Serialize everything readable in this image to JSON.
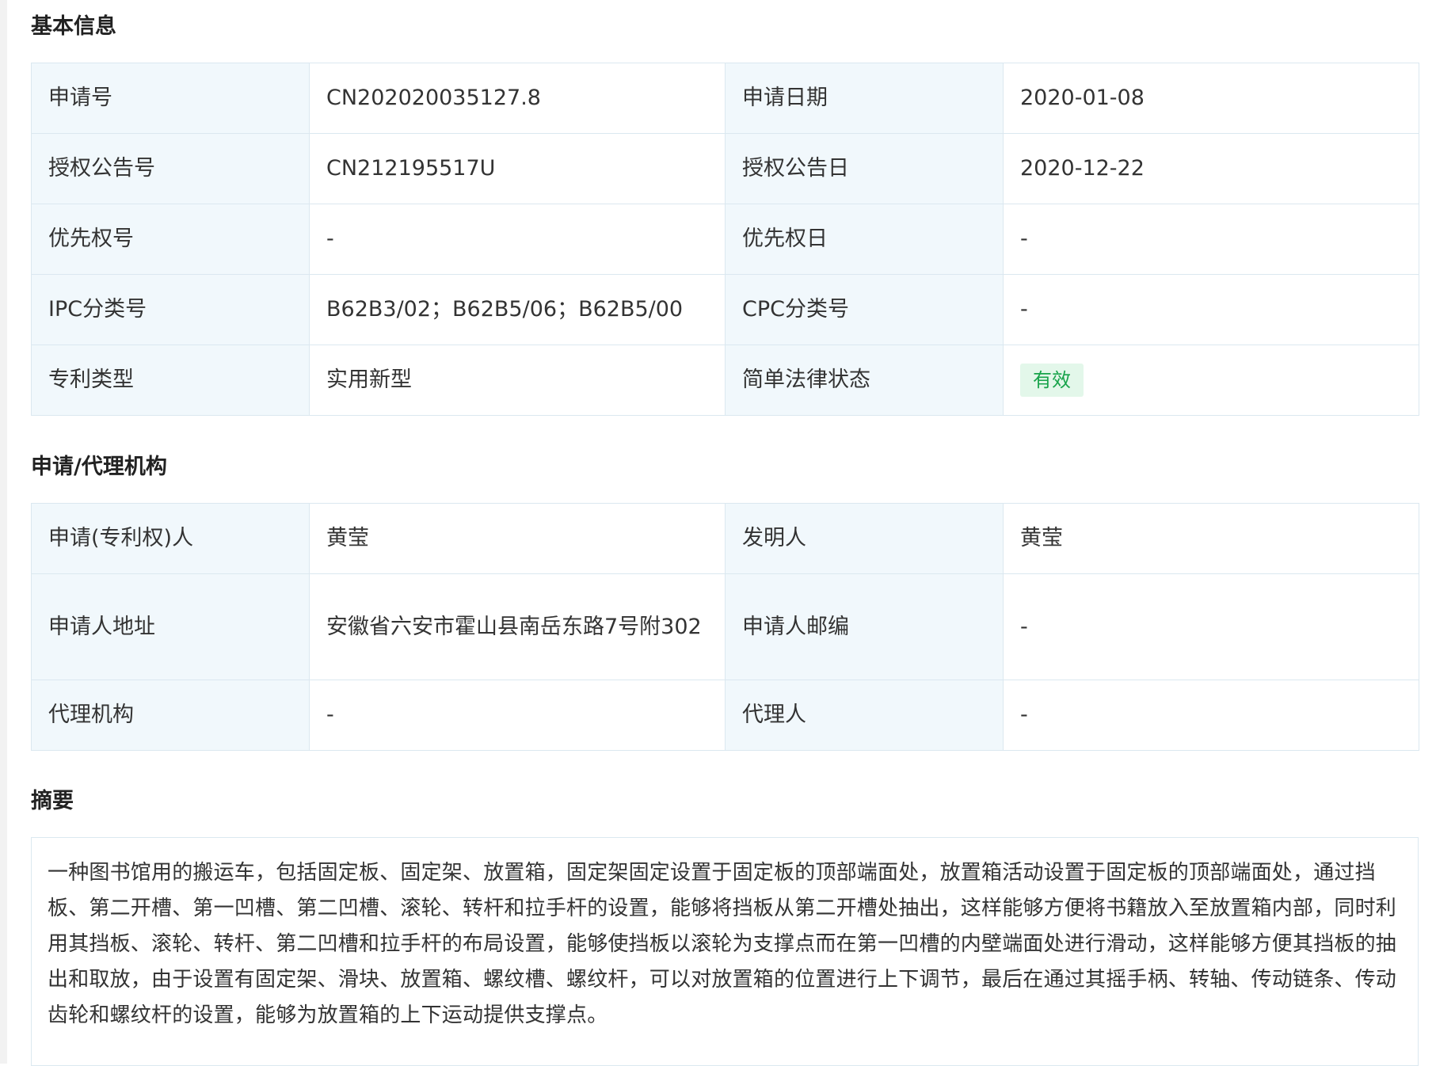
{
  "sections": {
    "basic_title": "基本信息",
    "agency_title": "申请/代理机构",
    "abstract_title": "摘要"
  },
  "basic_info": {
    "rows": [
      {
        "label1": "申请号",
        "value1": "CN202020035127.8",
        "label2": "申请日期",
        "value2": "2020-01-08"
      },
      {
        "label1": "授权公告号",
        "value1": "CN212195517U",
        "label2": "授权公告日",
        "value2": "2020-12-22"
      },
      {
        "label1": "优先权号",
        "value1": "-",
        "label2": "优先权日",
        "value2": "-"
      },
      {
        "label1": "IPC分类号",
        "value1": "B62B3/02；B62B5/06；B62B5/00",
        "label2": "CPC分类号",
        "value2": "-"
      },
      {
        "label1": "专利类型",
        "value1": "实用新型",
        "label2": "简单法律状态",
        "value2": "有效"
      }
    ],
    "status_color": "#17a34a"
  },
  "agency_info": {
    "rows": [
      {
        "label1": "申请(专利权)人",
        "value1": "黄莹",
        "label2": "发明人",
        "value2": "黄莹"
      },
      {
        "label1": "申请人地址",
        "value1": "安徽省六安市霍山县南岳东路7号附302",
        "label2": "申请人邮编",
        "value2": "-"
      },
      {
        "label1": "代理机构",
        "value1": "-",
        "label2": "代理人",
        "value2": "-"
      }
    ]
  },
  "abstract": {
    "text": "一种图书馆用的搬运车，包括固定板、固定架、放置箱，固定架固定设置于固定板的顶部端面处，放置箱活动设置于固定板的顶部端面处，通过挡板、第二开槽、第一凹槽、第二凹槽、滚轮、转杆和拉手杆的设置，能够将挡板从第二开槽处抽出，这样能够方便将书籍放入至放置箱内部，同时利用其挡板、滚轮、转杆、第二凹槽和拉手杆的布局设置，能够使挡板以滚轮为支撑点而在第一凹槽的内壁端面处进行滑动，这样能够方便其挡板的抽出和取放，由于设置有固定架、滑块、放置箱、螺纹槽、螺纹杆，可以对放置箱的位置进行上下调节，最后在通过其摇手柄、转轴、传动链条、传动齿轮和螺纹杆的设置，能够为放置箱的上下运动提供支撑点。"
  }
}
